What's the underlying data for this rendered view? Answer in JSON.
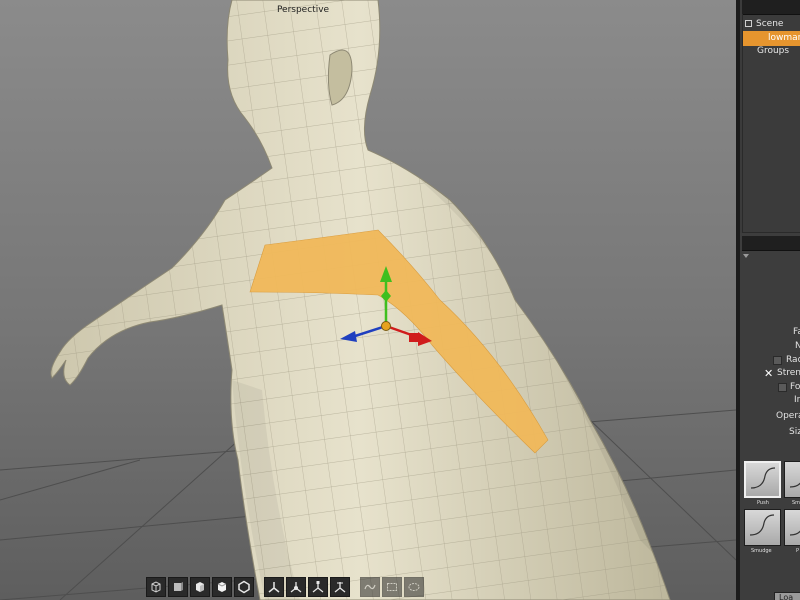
{
  "viewport": {
    "label": "Perspective",
    "toolbar": [
      "perspective-camera-icon",
      "front-view-icon",
      "side-view-icon",
      "top-view-icon",
      "frame-object-icon",
      "translate-axis-icon",
      "rotate-axis-icon",
      "scale-axis-icon",
      "universal-axis-icon",
      "lasso-select-icon",
      "marquee-select-icon",
      "ellipse-select-icon"
    ]
  },
  "outliner": {
    "scene_label": "Scene",
    "selected_object": "lowman",
    "groups_label": "Groups"
  },
  "tool_properties": {
    "labels": [
      "Fa",
      "N",
      "Rad",
      "Stren",
      "Fo",
      "In",
      "Operat",
      "Siz"
    ]
  },
  "brushes": [
    {
      "label": "Push",
      "selected": true
    },
    {
      "label": "Sm",
      "selected": false
    },
    {
      "label": "Smudge",
      "selected": false
    },
    {
      "label": "P",
      "selected": false
    }
  ],
  "load_button": "Loa",
  "colors": {
    "selection": "#e6952e",
    "mask": "#f1b95a",
    "axis_x": "#d01c1c",
    "axis_y": "#3fbf1e",
    "axis_z": "#1f3fbf"
  }
}
